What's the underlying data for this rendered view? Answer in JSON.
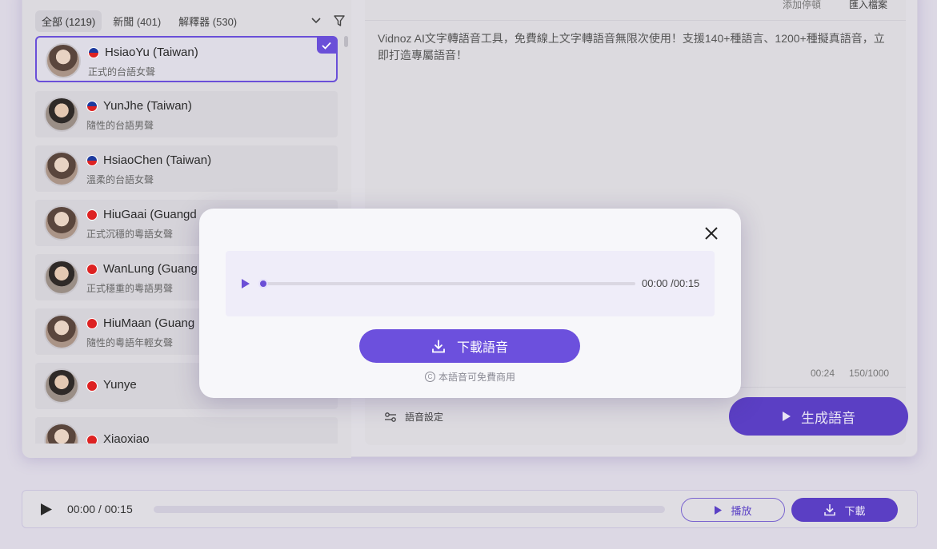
{
  "filter_tabs": [
    {
      "label": "全部 (1219)",
      "active": true
    },
    {
      "label": "新聞 (401)",
      "active": false
    },
    {
      "label": "解釋器 (530)",
      "active": false
    }
  ],
  "voices": [
    {
      "name": "HsiaoYu (Taiwan)",
      "desc": "正式的台語女聲",
      "flag": "tw",
      "selected": true
    },
    {
      "name": "YunJhe (Taiwan)",
      "desc": "隨性的台語男聲",
      "flag": "tw"
    },
    {
      "name": "HsiaoChen (Taiwan)",
      "desc": "溫柔的台語女聲",
      "flag": "tw"
    },
    {
      "name": "HiuGaai (Guangd",
      "desc": "正式沉穩的粵語女聲",
      "flag": "hk"
    },
    {
      "name": "WanLung (Guang",
      "desc": "正式穩重的粵語男聲",
      "flag": "hk"
    },
    {
      "name": "HiuMaan (Guang",
      "desc": "隨性的粵語年輕女聲",
      "flag": "hk"
    },
    {
      "name": "Yunye",
      "desc": "",
      "flag": "cn"
    },
    {
      "name": "Xiaoxiao",
      "desc": "",
      "flag": "cn"
    }
  ],
  "top_links": {
    "add_pause": "添加停頓",
    "import_file": "匯入檔案"
  },
  "editor": {
    "text": "Vidnoz AI文字轉語音工具，免費線上文字轉語音無限次使用！支援140+種語言、1200+種擬真語音，立即打造專屬語音！",
    "duration": "00:24",
    "char_count": "150/1000"
  },
  "settings_label": "語音設定",
  "generate_label": "生成語音",
  "bottom_player": {
    "time": "00:00 / 00:15",
    "play_label": "播放",
    "download_label": "下載",
    "progress": 0
  },
  "modal": {
    "time": "00:00 /00:15",
    "progress": 0,
    "download_label": "下載語音",
    "license_text": "本語音可免費商用"
  },
  "colors": {
    "accent": "#6c50dd",
    "accent_dark": "#5b3fc4"
  }
}
